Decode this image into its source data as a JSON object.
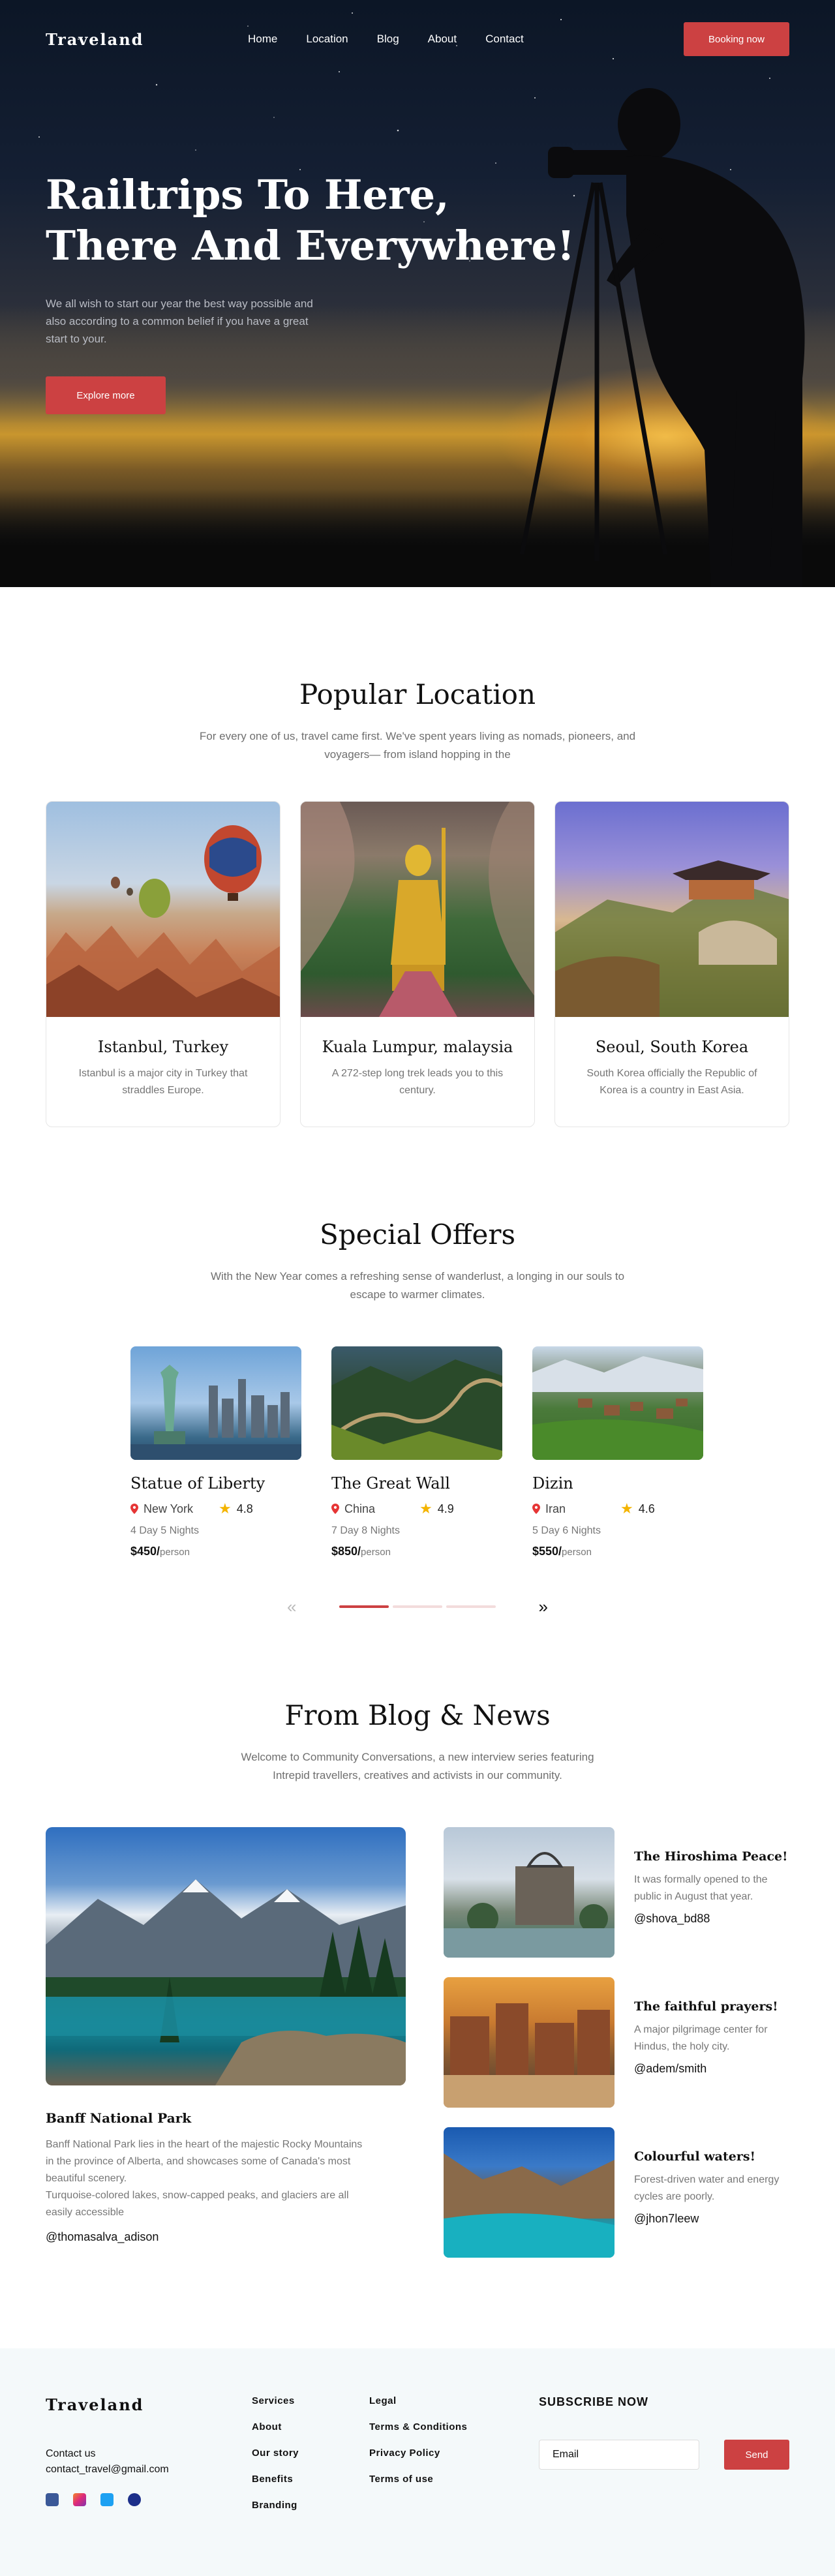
{
  "nav": {
    "logo": "Traveland",
    "links": [
      "Home",
      "Location",
      "Blog",
      "About",
      "Contact"
    ],
    "cta": "Booking now"
  },
  "hero": {
    "title_line1": "Railtrips To Here,",
    "title_line2": "There And Everywhere!",
    "subtitle": "We all wish to start our year the best way possible and also according to a common belief if you have a great start to your.",
    "cta": "Explore more"
  },
  "popular": {
    "title": "Popular Location",
    "subtitle": "For every one of us, travel came first. We've spent years living as nomads, pioneers, and voyagers— from island hopping in the",
    "cards": [
      {
        "name": "Istanbul, Turkey",
        "desc": "Istanbul is a major city in Turkey that straddles Europe."
      },
      {
        "name": "Kuala Lumpur, malaysia",
        "desc": "A 272-step long trek leads you to this century."
      },
      {
        "name": "Seoul, South Korea",
        "desc": "South Korea officially the Republic of Korea is a country in East Asia."
      }
    ]
  },
  "offers": {
    "title": "Special Offers",
    "subtitle": "With the New Year comes a refreshing sense of wanderlust, a longing in our souls to escape to warmer climates.",
    "items": [
      {
        "name": "Statue of Liberty",
        "city": "New York",
        "rating": "4.8",
        "duration": "4 Day 5 Nights",
        "price": "$450/",
        "unit": "person"
      },
      {
        "name": "The Great Wall",
        "city": "China",
        "rating": "4.9",
        "duration": "7 Day 8 Nights",
        "price": "$850/",
        "unit": "person"
      },
      {
        "name": "Dizin",
        "city": "Iran",
        "rating": "4.6",
        "duration": "5 Day 6 Nights",
        "price": "$550/",
        "unit": "person"
      }
    ],
    "prev": "«",
    "next": "»"
  },
  "blog": {
    "title": "From Blog & News",
    "subtitle": "Welcome to Community Conversations, a new interview series featuring Intrepid travellers, creatives and activists in our community.",
    "main": {
      "title": "Banff National Park",
      "body1": "Banff National Park lies in the heart of the majestic Rocky Mountains in the province of Alberta, and showcases some of Canada's most beautiful scenery.",
      "body2": "Turquoise-colored lakes, snow-capped peaks, and glaciers are all easily accessible",
      "author": "@thomasalva_adison"
    },
    "side": [
      {
        "title": "The Hiroshima Peace!",
        "body": "It was formally opened to the public in August that year.",
        "author": "@shova_bd88"
      },
      {
        "title": "The faithful prayers!",
        "body": "A major pilgrimage center for Hindus, the holy city.",
        "author": "@adem/smith"
      },
      {
        "title": "Colourful waters!",
        "body": "Forest-driven water and energy cycles are poorly.",
        "author": "@jhon7leew"
      }
    ]
  },
  "footer": {
    "logo": "Traveland",
    "contact_label": "Contact us",
    "email": "contact_travel@gmail.com",
    "col1": [
      "Services",
      "About",
      "Our story",
      "Benefits",
      "Branding"
    ],
    "col2": [
      "Legal",
      "Terms & Conditions",
      "Privacy Policy",
      "Terms of use"
    ],
    "subscribe_title": "SUBSCRIBE NOW",
    "email_placeholder": "Email",
    "send": "Send",
    "socials": [
      "facebook-icon",
      "instagram-icon",
      "twitter-icon",
      "pinterest-icon"
    ]
  },
  "colors": {
    "accent": "#cc4142",
    "footer_bg": "#f4f9fa"
  }
}
